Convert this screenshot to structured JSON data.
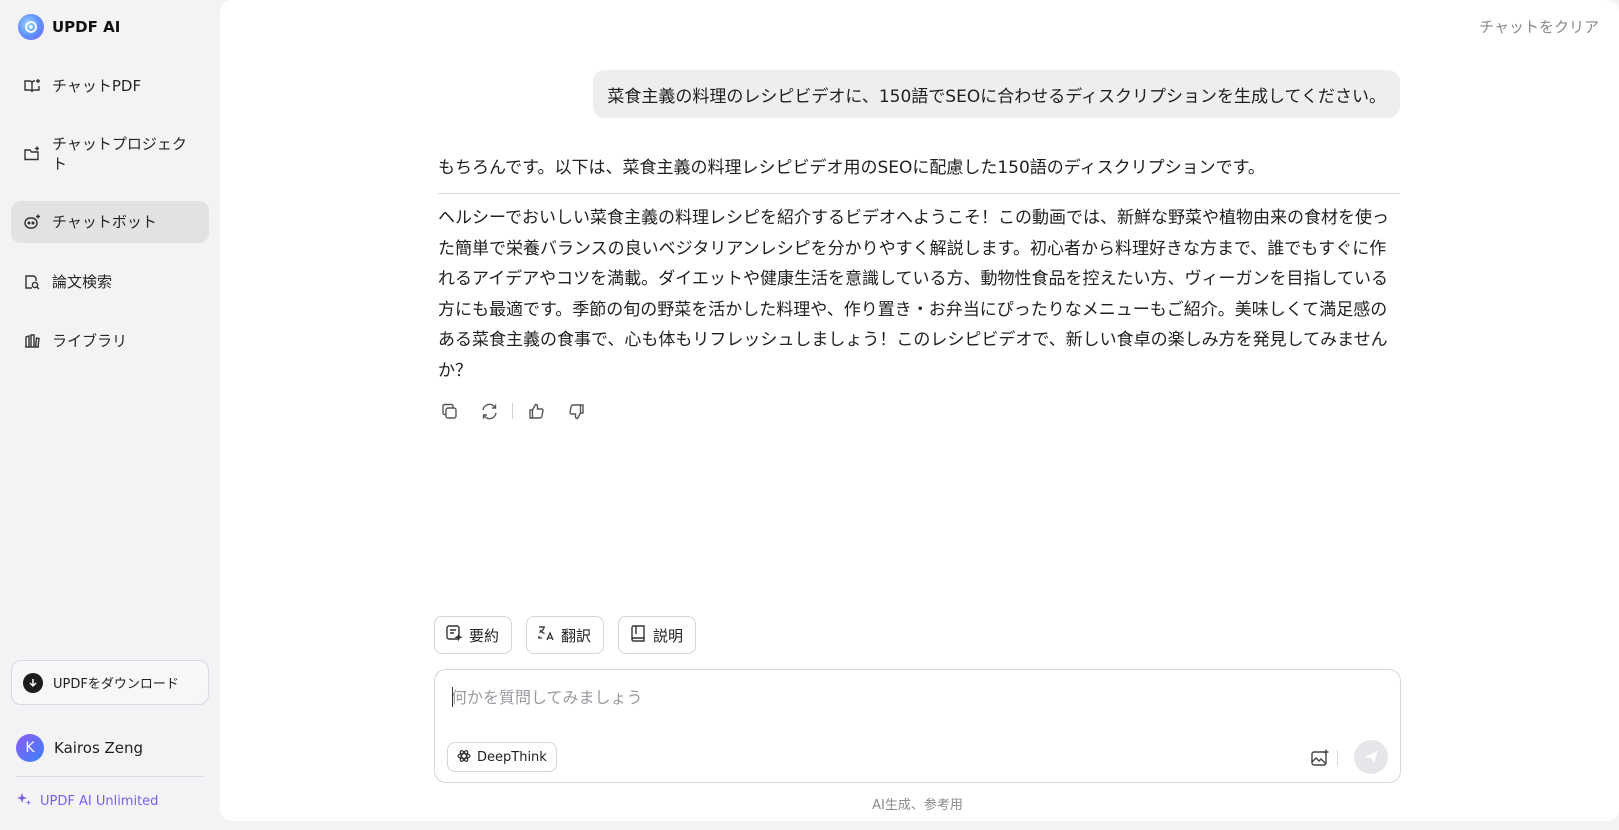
{
  "brand": {
    "name": "UPDF AI"
  },
  "sidebar": {
    "items": [
      {
        "label": "チャットPDF",
        "icon": "book-plus-icon"
      },
      {
        "label": "チャットプロジェクト",
        "icon": "folder-plus-icon"
      },
      {
        "label": "チャットボット",
        "icon": "bot-icon",
        "active": true
      },
      {
        "label": "論文検索",
        "icon": "doc-search-icon"
      },
      {
        "label": "ライブラリ",
        "icon": "library-icon"
      }
    ],
    "download_label": "UPDFをダウンロード",
    "user_initial": "K",
    "user_name": "Kairos Zeng",
    "plan_label": "UPDF AI Unlimited"
  },
  "header": {
    "clear_label": "チャットをクリア"
  },
  "conversation": {
    "user_message": "菜食主義の料理のレシピビデオに、150語でSEOに合わせるディスクリプションを生成してください。",
    "ai_intro": "もちろんです。以下は、菜食主義の料理レシピビデオ用のSEOに配慮した150語のディスクリプションです。",
    "ai_body": "ヘルシーでおいしい菜食主義の料理レシピを紹介するビデオへようこそ！この動画では、新鮮な野菜や植物由来の食材を使った簡単で栄養バランスの良いベジタリアンレシピを分かりやすく解説します。初心者から料理好きな方まで、誰でもすぐに作れるアイデアやコツを満載。ダイエットや健康生活を意識している方、動物性食品を控えたい方、ヴィーガンを目指している方にも最適です。季節の旬の野菜を活かした料理や、作り置き・お弁当にぴったりなメニューもご紹介。美味しくて満足感のある菜食主義の食事で、心も体もリフレッシュしましょう！このレシピビデオで、新しい食卓の楽しみ方を発見してみませんか？"
  },
  "quick_actions": [
    {
      "label": "要約",
      "icon": "summary-icon"
    },
    {
      "label": "翻訳",
      "icon": "translate-icon"
    },
    {
      "label": "説明",
      "icon": "explain-book-icon"
    }
  ],
  "input": {
    "placeholder": "何かを質問してみましょう",
    "deepthink_label": "DeepThink"
  },
  "footnote": "AI生成、参考用",
  "colors": {
    "accent": "#7c5cf0",
    "active_bg": "#e2e2e5"
  }
}
